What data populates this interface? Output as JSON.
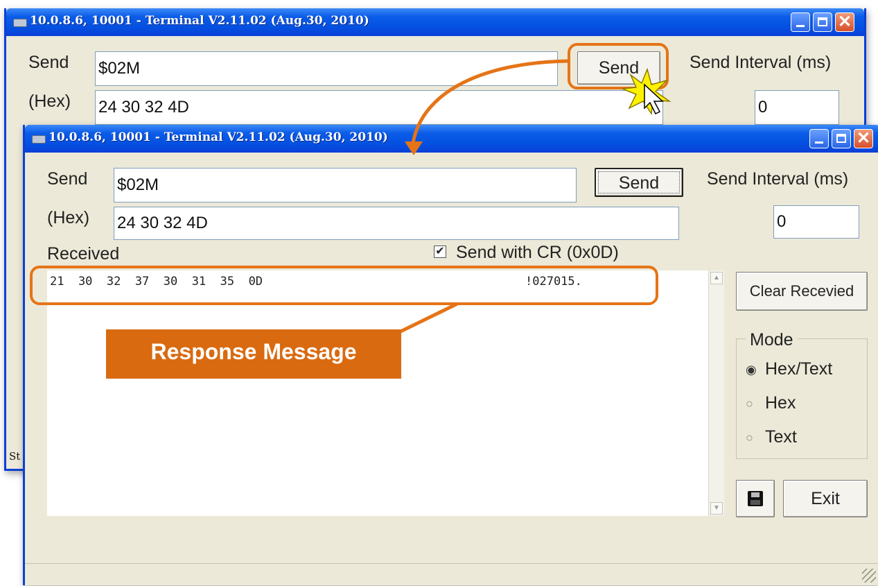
{
  "back_window": {
    "title": "10.0.8.6, 10001 - Terminal V2.11.02 (Aug.30, 2010)",
    "send_label": "Send",
    "hex_label": "(Hex)",
    "send_value": "$02M",
    "hex_value": "24 30 32 4D",
    "send_button": "Send",
    "interval_label": "Send Interval (ms)",
    "interval_value": "0",
    "status_text": "St"
  },
  "front_window": {
    "title": "10.0.8.6, 10001 - Terminal V2.11.02 (Aug.30, 2010)",
    "send_label": "Send",
    "hex_label": "(Hex)",
    "send_value": "$02M",
    "hex_value": "24 30 32 4D",
    "send_button": "Send",
    "interval_label": "Send Interval (ms)",
    "interval_value": "0",
    "received_label": "Received",
    "send_with_cr_label": "Send with CR (0x0D)",
    "send_with_cr_checked": true,
    "received_hex": "21  30  32  37  30  31  35  0D",
    "received_text": "!027015.",
    "clear_button": "Clear Recevied",
    "mode": {
      "label": "Mode",
      "options": [
        "Hex/Text",
        "Hex",
        "Text"
      ],
      "selected": "Hex/Text"
    },
    "exit_button": "Exit"
  },
  "annotation": {
    "callout_text": "Response Message",
    "color": "#e57417"
  }
}
